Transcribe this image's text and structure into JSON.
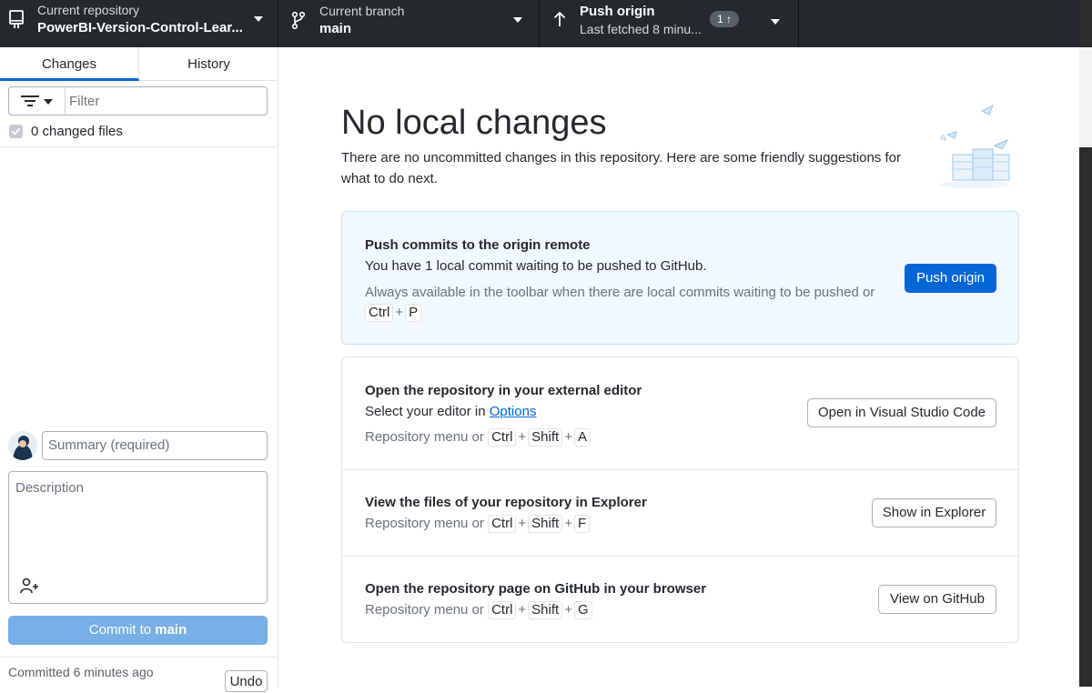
{
  "toolbar": {
    "repo": {
      "label": "Current repository",
      "value": "PowerBI-Version-Control-Lear..."
    },
    "branch": {
      "label": "Current branch",
      "value": "main"
    },
    "push": {
      "title": "Push origin",
      "subtitle": "Last fetched 8 minu...",
      "badge": "1 ↑"
    }
  },
  "sidebar": {
    "tabs": {
      "changes": "Changes",
      "history": "History"
    },
    "filter_placeholder": "Filter",
    "changed_files": "0 changed files",
    "summary_placeholder": "Summary (required)",
    "description_placeholder": "Description",
    "commit": {
      "prefix": "Commit to",
      "branch": "main"
    },
    "committed_text": "Committed 6 minutes ago",
    "undo_label": "Undo"
  },
  "main": {
    "title": "No local changes",
    "lead": "There are no uncommitted changes in this repository. Here are some friendly suggestions for what to do next.",
    "push_card": {
      "title": "Push commits to the origin remote",
      "text": "You have 1 local commit waiting to be pushed to GitHub.",
      "hint": "Always available in the toolbar when there are local commits waiting to be pushed or",
      "keys": [
        "Ctrl",
        "P"
      ],
      "button": "Push origin"
    },
    "editor_card": {
      "title": "Open the repository in your external editor",
      "text_prefix": "Select your editor in",
      "link": "Options",
      "hint_prefix": "Repository menu or",
      "keys": [
        "Ctrl",
        "Shift",
        "A"
      ],
      "button": "Open in Visual Studio Code"
    },
    "explorer_card": {
      "title": "View the files of your repository in Explorer",
      "hint_prefix": "Repository menu or",
      "keys": [
        "Ctrl",
        "Shift",
        "F"
      ],
      "button": "Show in Explorer"
    },
    "github_card": {
      "title": "Open the repository page on GitHub in your browser",
      "hint_prefix": "Repository menu or",
      "keys": [
        "Ctrl",
        "Shift",
        "G"
      ],
      "button": "View on GitHub"
    }
  },
  "colors": {
    "accent": "#0366d6",
    "toolbar": "#24292e",
    "commit_button": "#77afe6"
  }
}
